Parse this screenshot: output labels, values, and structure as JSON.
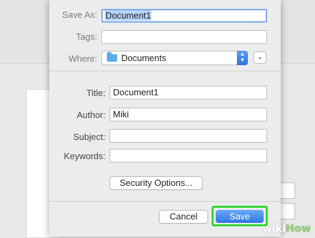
{
  "dialog": {
    "save_as_label": "Save As:",
    "save_as_value": "Document1",
    "tags_label": "Tags:",
    "tags_value": "",
    "where_label": "Where:",
    "where_value": "Documents",
    "title_label": "Title:",
    "title_value": "Document1",
    "author_label": "Author:",
    "author_value": "Miki",
    "subject_label": "Subject:",
    "subject_value": "",
    "keywords_label": "Keywords:",
    "keywords_value": "",
    "security_button": "Security Options...",
    "cancel_button": "Cancel",
    "save_button": "Save"
  },
  "icons": {
    "folder": "folder-icon",
    "stepper": "updown-stepper-icon",
    "disclosure": "chevron-down-icon"
  },
  "watermark": {
    "wiki": "wiki",
    "how": "How"
  },
  "colors": {
    "accent": "#2b76e3",
    "highlight": "#33d633",
    "folder": "#5aaee8",
    "selection": "#b5d3fa"
  }
}
